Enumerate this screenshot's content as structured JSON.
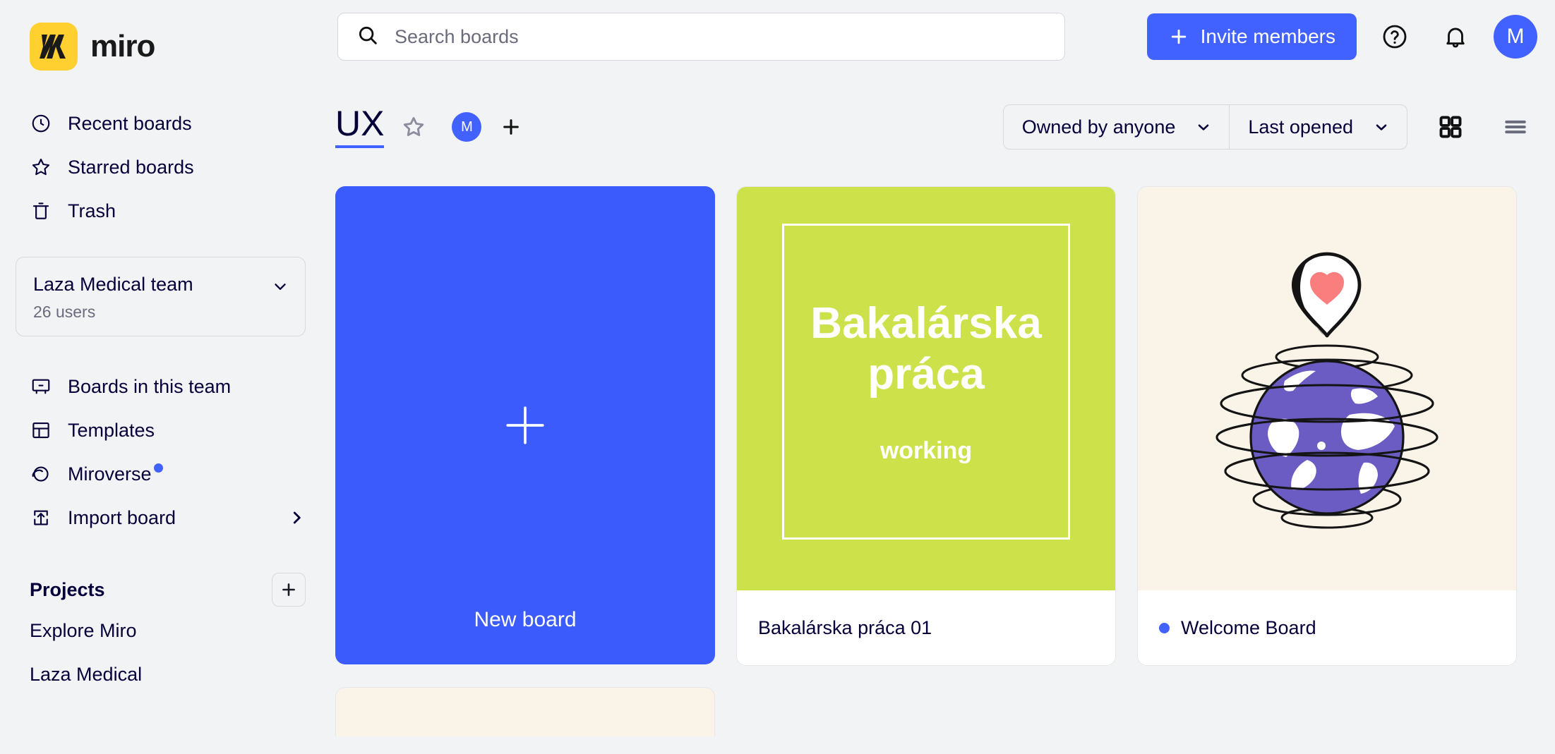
{
  "brand": {
    "name": "miro",
    "logo_color": "#ffd02f",
    "accent": "#4262ff"
  },
  "search": {
    "placeholder": "Search boards",
    "value": ""
  },
  "topbar": {
    "invite_label": "Invite members",
    "help_icon": "help-circle-icon",
    "bell_icon": "bell-icon",
    "avatar_initial": "M"
  },
  "sidebar": {
    "nav": [
      {
        "label": "Recent boards",
        "icon": "clock-icon"
      },
      {
        "label": "Starred boards",
        "icon": "star-icon"
      },
      {
        "label": "Trash",
        "icon": "trash-icon"
      }
    ],
    "team": {
      "name": "Laza Medical team",
      "users": "26 users"
    },
    "team_nav": [
      {
        "label": "Boards in this team",
        "icon": "board-icon"
      },
      {
        "label": "Templates",
        "icon": "template-icon"
      },
      {
        "label": "Miroverse",
        "icon": "planet-icon",
        "badge": true
      },
      {
        "label": "Import board",
        "icon": "import-icon",
        "chevron": true
      }
    ],
    "projects_title": "Projects",
    "projects": [
      {
        "label": "Explore Miro"
      },
      {
        "label": "Laza Medical"
      }
    ]
  },
  "page": {
    "title": "UX",
    "avatar_initial": "M",
    "filter_owner": "Owned by anyone",
    "filter_sort": "Last opened",
    "view_active": "grid"
  },
  "boards": {
    "new_board_label": "New board",
    "items": [
      {
        "name": "Bakalárska práca 01",
        "thumb_title": "Bakalárska práca",
        "thumb_sub": "working",
        "thumb_bg": "#cde24a",
        "has_dot": false
      },
      {
        "name": "Welcome Board",
        "thumb_title": "",
        "thumb_sub": "",
        "thumb_bg": "#faf3e8",
        "has_dot": true
      }
    ]
  }
}
